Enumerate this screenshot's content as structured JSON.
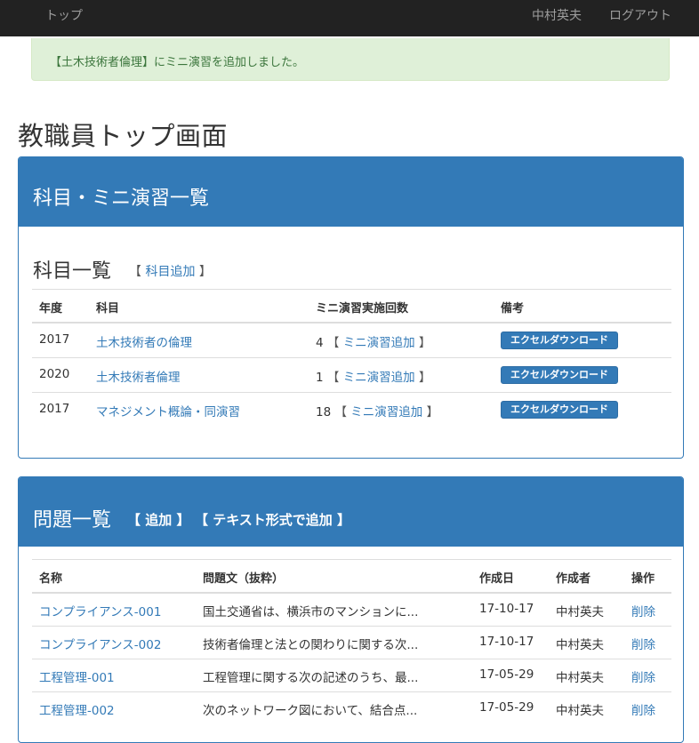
{
  "navbar": {
    "brand": "トップ",
    "user": "中村英夫",
    "logout": "ログアウト"
  },
  "alert": {
    "message": "【土木技術者倫理】にミニ演習を追加しました。"
  },
  "page_title": "教職員トップ画面",
  "panel1": {
    "title": "科目・ミニ演習一覧",
    "section_title": "科目一覧",
    "add_link": "科目追加",
    "headers": {
      "year": "年度",
      "subject": "科目",
      "count": "ミニ演習実施回数",
      "note": "備考"
    },
    "rows": [
      {
        "year": "2017",
        "subject": "土木技術者の倫理",
        "count": "4",
        "add": "ミニ演習追加",
        "button": "エクセルダウンロード"
      },
      {
        "year": "2020",
        "subject": "土木技術者倫理",
        "count": "1",
        "add": "ミニ演習追加",
        "button": "エクセルダウンロード"
      },
      {
        "year": "2017",
        "subject": "マネジメント概論・同演習",
        "count": "18",
        "add": "ミニ演習追加",
        "button": "エクセルダウンロード"
      }
    ]
  },
  "panel2": {
    "title": "問題一覧",
    "add_link": "追加",
    "text_add_link": "テキスト形式で追加",
    "headers": {
      "name": "名称",
      "text": "問題文（抜粋）",
      "date": "作成日",
      "author": "作成者",
      "action": "操作"
    },
    "rows": [
      {
        "name": "コンプライアンス-001",
        "text": "国土交通省は、横浜市のマンションに...",
        "date": "17-10-17",
        "author": "中村英夫",
        "action": "削除"
      },
      {
        "name": "コンプライアンス-002",
        "text": "技術者倫理と法との関わりに関する次...",
        "date": "17-10-17",
        "author": "中村英夫",
        "action": "削除"
      },
      {
        "name": "工程管理-001",
        "text": "工程管理に関する次の記述のうち、最...",
        "date": "17-05-29",
        "author": "中村英夫",
        "action": "削除"
      },
      {
        "name": "工程管理-002",
        "text": "次のネットワーク図において、結合点...",
        "date": "17-05-29",
        "author": "中村英夫",
        "action": "削除"
      }
    ]
  }
}
